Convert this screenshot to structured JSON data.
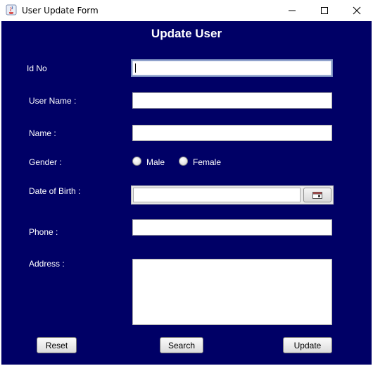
{
  "window": {
    "title": "User Update Form",
    "controls": {
      "minimize": "minimize-icon",
      "maximize": "maximize-icon",
      "close": "close-icon"
    }
  },
  "form": {
    "heading": "Update User",
    "fields": {
      "id_no": {
        "label": "Id No",
        "value": ""
      },
      "user_name": {
        "label": "User Name :",
        "value": ""
      },
      "name": {
        "label": "Name :",
        "value": ""
      },
      "gender": {
        "label": "Gender :",
        "options": [
          "Male",
          "Female"
        ],
        "selected": ""
      },
      "dob": {
        "label": "Date of Birth :",
        "value": "",
        "picker_icon": "calendar-icon"
      },
      "phone": {
        "label": "Phone :",
        "value": ""
      },
      "address": {
        "label": "Address :",
        "value": ""
      }
    },
    "buttons": {
      "reset": "Reset",
      "search": "Search",
      "update": "Update"
    }
  },
  "colors": {
    "background": "#000066",
    "text": "#ffffff"
  }
}
